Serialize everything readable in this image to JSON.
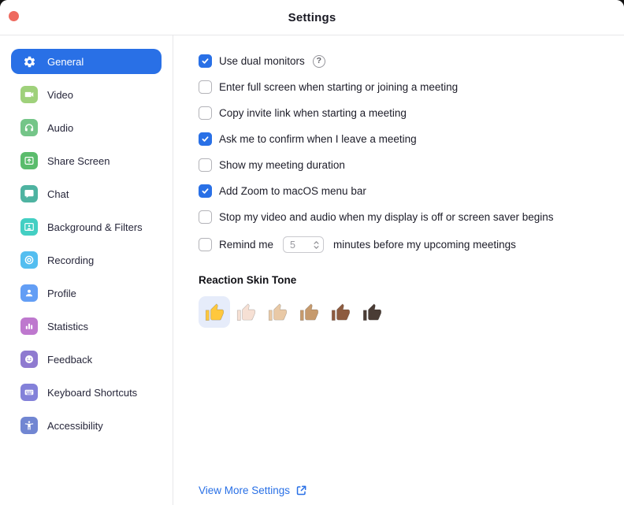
{
  "window": {
    "title": "Settings",
    "close_color": "#EE6A5F"
  },
  "colors": {
    "accent": "#2970E6",
    "divider": "#E7E7E9",
    "selected_tone_bg": "#E6ECFA",
    "link": "#2970E6"
  },
  "sidebar": {
    "items": [
      {
        "label": "General",
        "icon": "gear-icon",
        "color": "#2970E6",
        "selected": true
      },
      {
        "label": "Video",
        "icon": "video-camera-icon",
        "color": "#9FD17B",
        "selected": false
      },
      {
        "label": "Audio",
        "icon": "headphones-icon",
        "color": "#74C588",
        "selected": false
      },
      {
        "label": "Share Screen",
        "icon": "share-screen-icon",
        "color": "#5BBC6C",
        "selected": false
      },
      {
        "label": "Chat",
        "icon": "chat-bubble-icon",
        "color": "#4EB3A1",
        "selected": false
      },
      {
        "label": "Background & Filters",
        "icon": "person-frame-icon",
        "color": "#43CFC3",
        "selected": false
      },
      {
        "label": "Recording",
        "icon": "record-icon",
        "color": "#54BEF0",
        "selected": false
      },
      {
        "label": "Profile",
        "icon": "person-icon",
        "color": "#639EF5",
        "selected": false
      },
      {
        "label": "Statistics",
        "icon": "bar-chart-icon",
        "color": "#BE78CE",
        "selected": false
      },
      {
        "label": "Feedback",
        "icon": "smiley-icon",
        "color": "#8F7AD0",
        "selected": false
      },
      {
        "label": "Keyboard Shortcuts",
        "icon": "keyboard-icon",
        "color": "#8381D9",
        "selected": false
      },
      {
        "label": "Accessibility",
        "icon": "accessibility-icon",
        "color": "#7186D2",
        "selected": false
      }
    ]
  },
  "main": {
    "help_glyph": "?",
    "checkboxes": [
      {
        "label": "Use dual monitors",
        "checked": true,
        "help": true
      },
      {
        "label": "Enter full screen when starting or joining a meeting",
        "checked": false
      },
      {
        "label": "Copy invite link when starting a meeting",
        "checked": false
      },
      {
        "label": "Ask me to confirm when I leave a meeting",
        "checked": true
      },
      {
        "label": "Show my meeting duration",
        "checked": false
      },
      {
        "label": "Add Zoom to macOS menu bar",
        "checked": true
      },
      {
        "label": "Stop my video and audio when my display is off or screen saver begins",
        "checked": false
      },
      {
        "label": "Remind me",
        "checked": false,
        "stepper_value": "5",
        "suffix": "minutes before my upcoming meetings"
      }
    ],
    "skin_tone": {
      "title": "Reaction Skin Tone",
      "tones": [
        {
          "name": "default",
          "color": "#FFC83D",
          "selected": true
        },
        {
          "name": "light",
          "color": "#F6E0D4",
          "selected": false
        },
        {
          "name": "medium-light",
          "color": "#E9C9A6",
          "selected": false
        },
        {
          "name": "medium",
          "color": "#C69A6D",
          "selected": false
        },
        {
          "name": "medium-dark",
          "color": "#8D5B3F",
          "selected": false
        },
        {
          "name": "dark",
          "color": "#4A3C35",
          "selected": false
        }
      ]
    },
    "footer_link": {
      "label": "View More Settings"
    }
  }
}
